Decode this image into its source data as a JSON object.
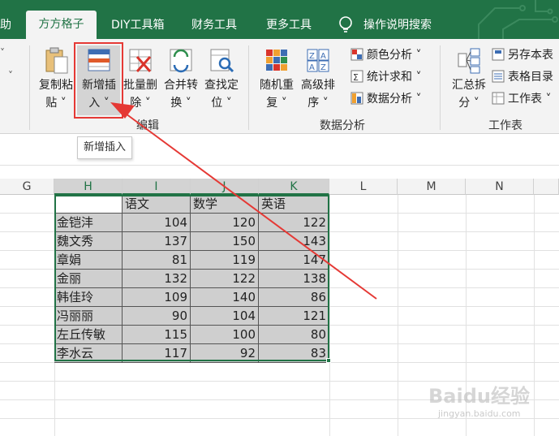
{
  "ribbon_tabs": {
    "help": "助",
    "active": "方方格子",
    "diy": "DIY工具箱",
    "finance": "财务工具",
    "more": "更多工具",
    "tell_me": "操作说明搜索"
  },
  "editing_group": {
    "copy_paste": [
      "复制粘",
      "贴 ˅"
    ],
    "new_insert": [
      "新增插",
      "入 ˅"
    ],
    "batch_delete": [
      "批量删",
      "除 ˅"
    ],
    "merge_convert": [
      "合并转",
      "换 ˅"
    ],
    "find_locate": [
      "查找定",
      "位 ˅"
    ],
    "label_partial": "编辑"
  },
  "data_analysis_group": {
    "random_repeat": [
      "随机重",
      "复 ˅"
    ],
    "advanced_sort": [
      "高级排",
      "序 ˅"
    ],
    "color_analysis": "颜色分析 ˅",
    "stat_sum": "统计求和 ˅",
    "data_analysis": "数据分析 ˅",
    "label": "数据分析"
  },
  "worksheet_group": {
    "summary_split": [
      "汇总拆",
      "分 ˅"
    ],
    "save_as_this": "另存本表",
    "table_directory": "表格目录",
    "worksheet": "工作表 ˅",
    "label": "工作表"
  },
  "tooltip": "新增插入",
  "columns": [
    "G",
    "H",
    "I",
    "J",
    "K",
    "L",
    "M",
    "N"
  ],
  "table": {
    "headers": [
      "",
      "语文",
      "数学",
      "英语"
    ],
    "rows": [
      [
        "金铠沣",
        "104",
        "120",
        "122"
      ],
      [
        "魏文秀",
        "137",
        "150",
        "143"
      ],
      [
        "章娟",
        "81",
        "119",
        "147"
      ],
      [
        "金丽",
        "132",
        "122",
        "138"
      ],
      [
        "韩佳玲",
        "109",
        "140",
        "86"
      ],
      [
        "冯丽丽",
        "90",
        "104",
        "121"
      ],
      [
        "左丘传敏",
        "115",
        "100",
        "80"
      ],
      [
        "李水云",
        "117",
        "92",
        "83"
      ]
    ]
  },
  "watermark": {
    "main": "Baidu经验",
    "sub": "jingyan.baidu.com"
  },
  "colors": {
    "excel_green": "#217346",
    "highlight_red": "#e53935",
    "cell_gray": "#cfcfcf"
  }
}
